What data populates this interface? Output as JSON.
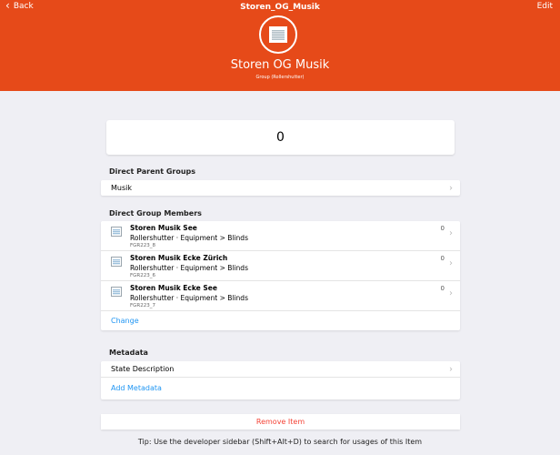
{
  "nav": {
    "back_label": "Back",
    "title": "Storen_OG_Musik",
    "edit_label": "Edit"
  },
  "header": {
    "icon": "rollershutter-icon",
    "name": "Storen OG Musik",
    "subtitle": "Group (Rollershutter)"
  },
  "state": {
    "value": "0"
  },
  "parent_groups": {
    "title": "Direct Parent Groups",
    "items": [
      {
        "label": "Musik"
      }
    ]
  },
  "members": {
    "title": "Direct Group Members",
    "items": [
      {
        "name": "Storen Musik See",
        "type": "Rollershutter · Equipment > Blinds",
        "id": "FGR223_8",
        "state": "0"
      },
      {
        "name": "Storen Musik Ecke Zürich",
        "type": "Rollershutter · Equipment > Blinds",
        "id": "FGR223_6",
        "state": "0"
      },
      {
        "name": "Storen Musik Ecke See",
        "type": "Rollershutter · Equipment > Blinds",
        "id": "FGR223_7",
        "state": "0"
      }
    ],
    "change_label": "Change"
  },
  "metadata": {
    "title": "Metadata",
    "items": [
      {
        "label": "State Description"
      }
    ],
    "add_label": "Add Metadata"
  },
  "remove_label": "Remove Item",
  "tip": "Tip: Use the developer sidebar (Shift+Alt+D) to search for usages of this Item",
  "colors": {
    "header_bg": "#e64a19",
    "link": "#2196f3",
    "danger": "#f44336",
    "page_bg": "#efeff4"
  }
}
